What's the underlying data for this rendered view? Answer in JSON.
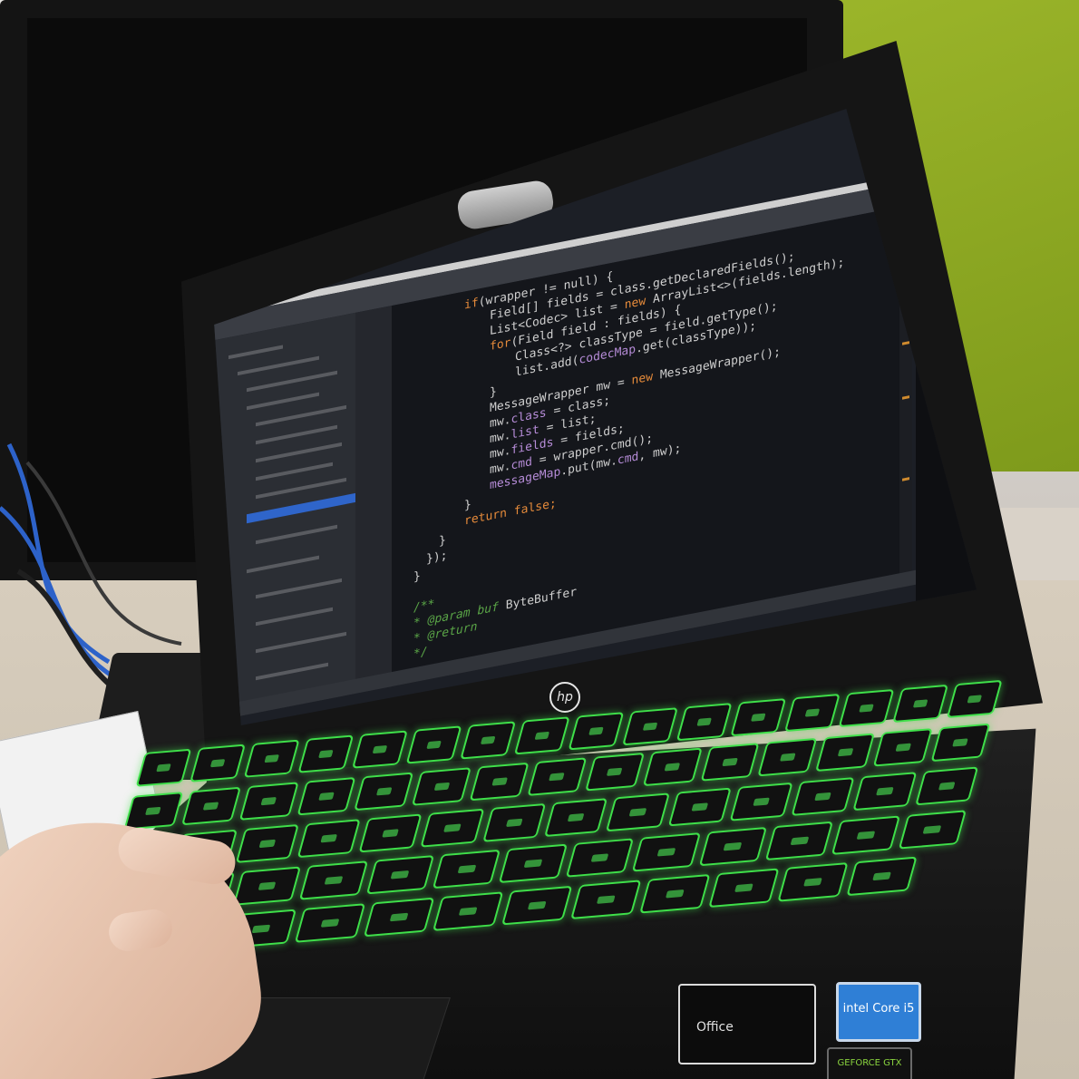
{
  "scene": {
    "description_colors": {
      "wall": "#e4e2df",
      "green_panel": "#8aa522",
      "keyboard_backlight": "#3fe04a",
      "laptop_body": "#151515"
    }
  },
  "laptop": {
    "brand_logo": "hp",
    "stickers": {
      "office": "Office",
      "intel": "intel Core i5",
      "gpu": "GEFORCE GTX"
    }
  },
  "ide": {
    "code_lines": [
      {
        "indent": 5,
        "parts": [
          {
            "t": "if",
            "c": "kw"
          },
          {
            "t": "(wrapper != null) {",
            "c": "ty"
          }
        ]
      },
      {
        "indent": 7,
        "parts": [
          {
            "t": "Field[] fields = class.getDeclaredFields();",
            "c": "ty"
          }
        ]
      },
      {
        "indent": 7,
        "parts": [
          {
            "t": "List<Codec> list = ",
            "c": "ty"
          },
          {
            "t": "new",
            "c": "kw"
          },
          {
            "t": " ArrayList<>(fields.length);",
            "c": "ty"
          }
        ]
      },
      {
        "indent": 7,
        "parts": [
          {
            "t": "for",
            "c": "kw"
          },
          {
            "t": "(Field field : fields) {",
            "c": "ty"
          }
        ]
      },
      {
        "indent": 9,
        "parts": [
          {
            "t": "Class<?> classType = field.getType();",
            "c": "ty"
          }
        ]
      },
      {
        "indent": 9,
        "parts": [
          {
            "t": "list.add(",
            "c": "ty"
          },
          {
            "t": "codecMap",
            "c": "fld"
          },
          {
            "t": ".get(classType));",
            "c": "ty"
          }
        ]
      },
      {
        "indent": 7,
        "parts": [
          {
            "t": "}",
            "c": "ty"
          }
        ]
      },
      {
        "indent": 7,
        "parts": [
          {
            "t": "MessageWrapper mw = ",
            "c": "ty"
          },
          {
            "t": "new",
            "c": "kw"
          },
          {
            "t": " MessageWrapper();",
            "c": "ty"
          }
        ]
      },
      {
        "indent": 7,
        "parts": [
          {
            "t": "mw.",
            "c": "ty"
          },
          {
            "t": "class",
            "c": "fld"
          },
          {
            "t": " = class;",
            "c": "ty"
          }
        ]
      },
      {
        "indent": 7,
        "parts": [
          {
            "t": "mw.",
            "c": "ty"
          },
          {
            "t": "list",
            "c": "fld"
          },
          {
            "t": " = list;",
            "c": "ty"
          }
        ]
      },
      {
        "indent": 7,
        "parts": [
          {
            "t": "mw.",
            "c": "ty"
          },
          {
            "t": "fields",
            "c": "fld"
          },
          {
            "t": " = fields;",
            "c": "ty"
          }
        ]
      },
      {
        "indent": 7,
        "parts": [
          {
            "t": "mw.",
            "c": "ty"
          },
          {
            "t": "cmd",
            "c": "fld"
          },
          {
            "t": " = wrapper.cmd();",
            "c": "ty"
          }
        ]
      },
      {
        "indent": 7,
        "parts": [
          {
            "t": "messageMap",
            "c": "fld"
          },
          {
            "t": ".put(mw.",
            "c": "ty"
          },
          {
            "t": "cmd",
            "c": "fld"
          },
          {
            "t": ", mw);",
            "c": "ty"
          }
        ]
      },
      {
        "indent": 5,
        "parts": [
          {
            "t": "}",
            "c": "ty"
          }
        ]
      },
      {
        "indent": 5,
        "parts": [
          {
            "t": "return false;",
            "c": "kw"
          }
        ]
      },
      {
        "indent": 3,
        "parts": [
          {
            "t": "}",
            "c": "ty"
          }
        ]
      },
      {
        "indent": 2,
        "parts": [
          {
            "t": "});",
            "c": "ty"
          }
        ]
      },
      {
        "indent": 1,
        "parts": [
          {
            "t": "}",
            "c": "ty"
          }
        ]
      },
      {
        "indent": 0,
        "parts": [
          {
            "t": "",
            "c": "ty"
          }
        ]
      },
      {
        "indent": 1,
        "parts": [
          {
            "t": "/**",
            "c": "cm"
          }
        ]
      },
      {
        "indent": 1,
        "parts": [
          {
            "t": " * @param buf ",
            "c": "cm"
          },
          {
            "t": "ByteBuffer",
            "c": "ty"
          }
        ]
      },
      {
        "indent": 1,
        "parts": [
          {
            "t": " * @return",
            "c": "cm"
          }
        ]
      },
      {
        "indent": 1,
        "parts": [
          {
            "t": " */",
            "c": "cm"
          }
        ]
      }
    ]
  }
}
